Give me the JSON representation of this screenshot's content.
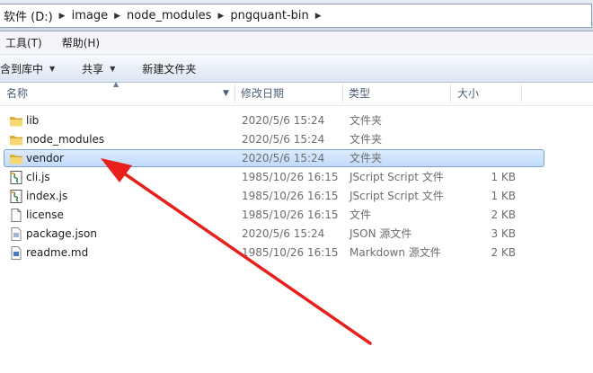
{
  "breadcrumb": {
    "items": [
      "软件 (D:)",
      "image",
      "node_modules",
      "pngquant-bin"
    ]
  },
  "menu": {
    "items": [
      "工具(T)",
      "帮助(H)"
    ]
  },
  "commands": {
    "include_library": "含到库中",
    "share": "共享",
    "new_folder": "新建文件夹"
  },
  "columns": {
    "name": "名称",
    "modified": "修改日期",
    "type": "类型",
    "size": "大小"
  },
  "files": [
    {
      "name": "lib",
      "modified": "2020/5/6 15:24",
      "type": "文件夹",
      "size": "",
      "icon": "folder-icon",
      "selected": false
    },
    {
      "name": "node_modules",
      "modified": "2020/5/6 15:24",
      "type": "文件夹",
      "size": "",
      "icon": "folder-icon",
      "selected": false
    },
    {
      "name": "vendor",
      "modified": "2020/5/6 15:24",
      "type": "文件夹",
      "size": "",
      "icon": "folder-icon",
      "selected": true
    },
    {
      "name": "cli.js",
      "modified": "1985/10/26 16:15",
      "type": "JScript Script 文件",
      "size": "1 KB",
      "icon": "script-file-icon",
      "selected": false
    },
    {
      "name": "index.js",
      "modified": "1985/10/26 16:15",
      "type": "JScript Script 文件",
      "size": "1 KB",
      "icon": "script-file-icon",
      "selected": false
    },
    {
      "name": "license",
      "modified": "1985/10/26 16:15",
      "type": "文件",
      "size": "2 KB",
      "icon": "blank-file-icon",
      "selected": false
    },
    {
      "name": "package.json",
      "modified": "2020/5/6 15:24",
      "type": "JSON 源文件",
      "size": "3 KB",
      "icon": "json-file-icon",
      "selected": false
    },
    {
      "name": "readme.md",
      "modified": "1985/10/26 16:15",
      "type": "Markdown 源文件",
      "size": "2 KB",
      "icon": "markdown-file-icon",
      "selected": false
    }
  ],
  "colors": {
    "selection_fill": "#c9e0fc",
    "selection_border": "#7da2ce",
    "annotation_arrow": "#e8201c",
    "folder": "#f2c94c"
  }
}
